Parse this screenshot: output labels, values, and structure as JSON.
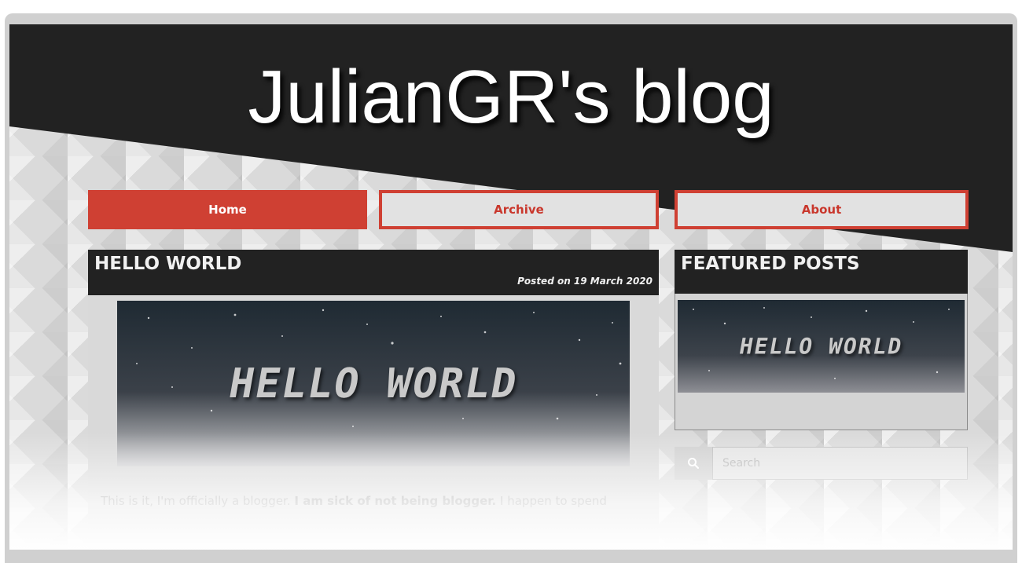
{
  "header": {
    "blog_title": "JulianGR's blog"
  },
  "nav": {
    "home": "Home",
    "archive": "Archive",
    "about": "About"
  },
  "post": {
    "title": "HELLO WORLD",
    "posted": "Posted on 19 March 2020",
    "banner_text": "HELLO WORLD",
    "body_start": "This is it, I'm officially a blogger.",
    "body_bold": "I am sick of not being blogger.",
    "body_end": "I happen to spend"
  },
  "sidebar": {
    "featured_title": "FEATURED POSTS",
    "featured_banner_text": "HELLO WORLD",
    "search_placeholder": "Search"
  },
  "colors": {
    "header_dark": "#222222",
    "accent_red": "#cf4033",
    "nav_inactive_bg": "#e2e2e2"
  },
  "icons": {
    "search": "search-icon"
  }
}
